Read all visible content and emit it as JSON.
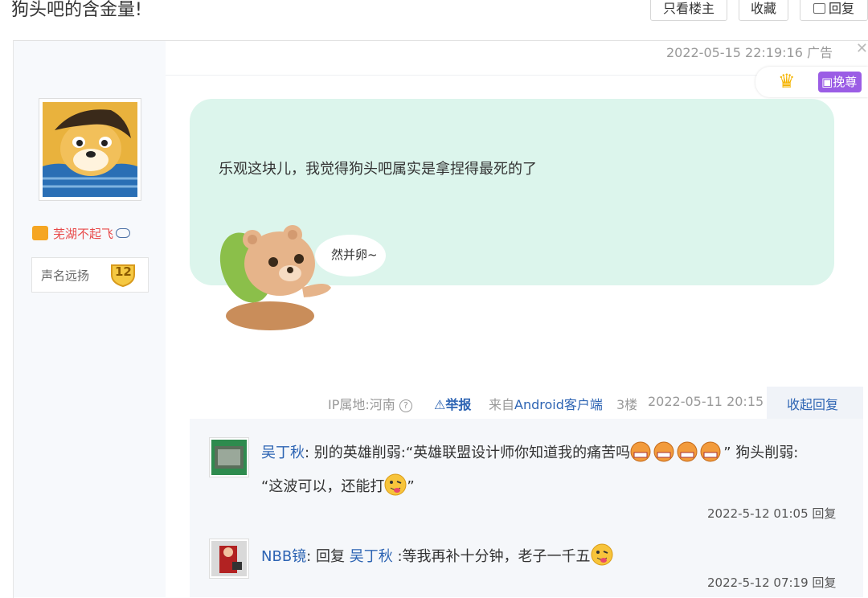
{
  "header": {
    "title": "狗头吧的含金量!",
    "btn_only_author": "只看楼主",
    "btn_favorite": "收藏",
    "btn_reply": "回复"
  },
  "ad": {
    "time": "2022-05-15 22:19:16",
    "label": "广告"
  },
  "badge": {
    "text": "挽尊"
  },
  "author": {
    "name": "芜湖不起飞",
    "rank_title": "声名远扬",
    "level": "12"
  },
  "post": {
    "text": "乐观这块儿，我觉得狗头吧属实是拿捏得最死的了",
    "sticker_text": "然并卵~",
    "ip": "IP属地:河南",
    "report": "举报",
    "source": "来自Android客户端",
    "floor": "3楼",
    "time": "2022-05-11 20:15",
    "collapse": "收起回复"
  },
  "replies": [
    {
      "user": "吴丁秋",
      "text_a": "别的英雄削弱:“英雄联盟设计师你知道我的痛苦吗",
      "text_b": "” 狗头削弱:",
      "text_c": "“这波可以，还能打",
      "text_d": "”",
      "time": "2022-5-12 01:05",
      "reply_label": "回复"
    },
    {
      "user": "NBB镜",
      "text_prefix": "回复",
      "target": "吴丁秋",
      "text": ":等我再补十分钟，老子一千五",
      "time": "2022-5-12 07:19",
      "reply_label": "回复"
    }
  ],
  "colors": {
    "link": "#2d64b3",
    "bubble": "#dcf5ec",
    "username_red": "#e84a4a"
  }
}
